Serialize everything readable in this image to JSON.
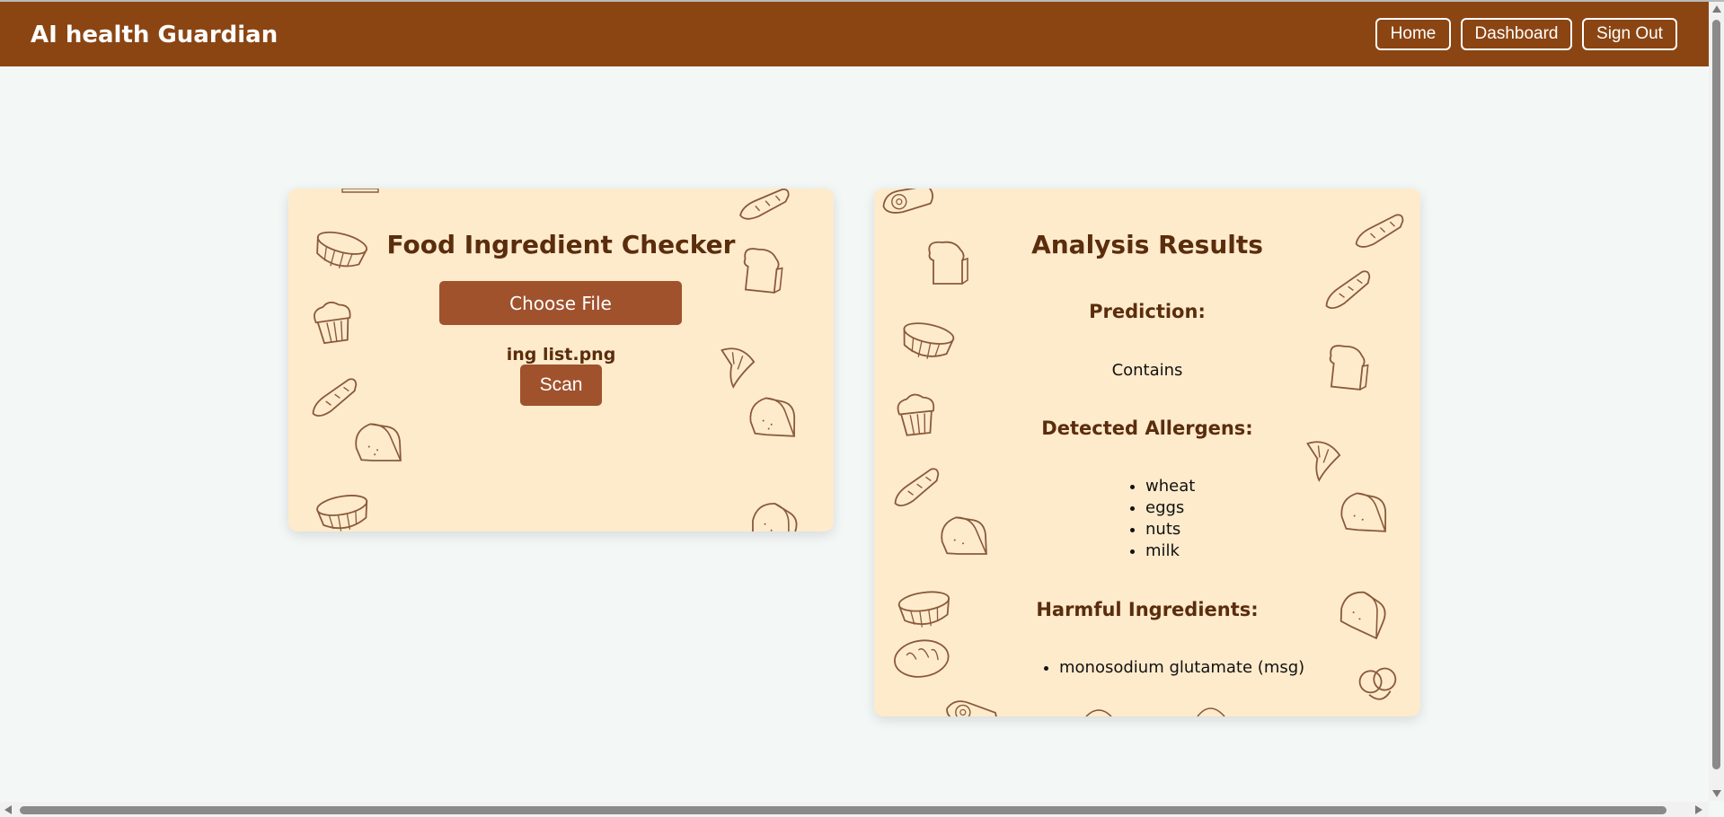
{
  "app": {
    "brand": "AI health Guardian"
  },
  "nav": {
    "home": "Home",
    "dashboard": "Dashboard",
    "signout": "Sign Out"
  },
  "checker": {
    "title": "Food Ingredient Checker",
    "choose_file": "Choose File",
    "file_name": "ing list.png",
    "scan": "Scan"
  },
  "results": {
    "title": "Analysis Results",
    "prediction_label": "Prediction:",
    "prediction_value": "Contains",
    "allergens_label": "Detected Allergens:",
    "allergens": [
      "wheat",
      "eggs",
      "nuts",
      "milk"
    ],
    "harmful_label": "Harmful Ingredients:",
    "harmful": [
      "monosodium glutamate (msg)"
    ]
  },
  "colors": {
    "navbar": "#8b4513",
    "card": "#feebcc",
    "button": "#a0522d",
    "heading": "#5a2d0c",
    "page": "#f3f7f6"
  },
  "icons": [
    "bread-loaf-icon",
    "baguette-icon",
    "croissant-icon",
    "muffin-icon",
    "cake-roll-icon",
    "pretzel-icon",
    "toast-icon"
  ]
}
